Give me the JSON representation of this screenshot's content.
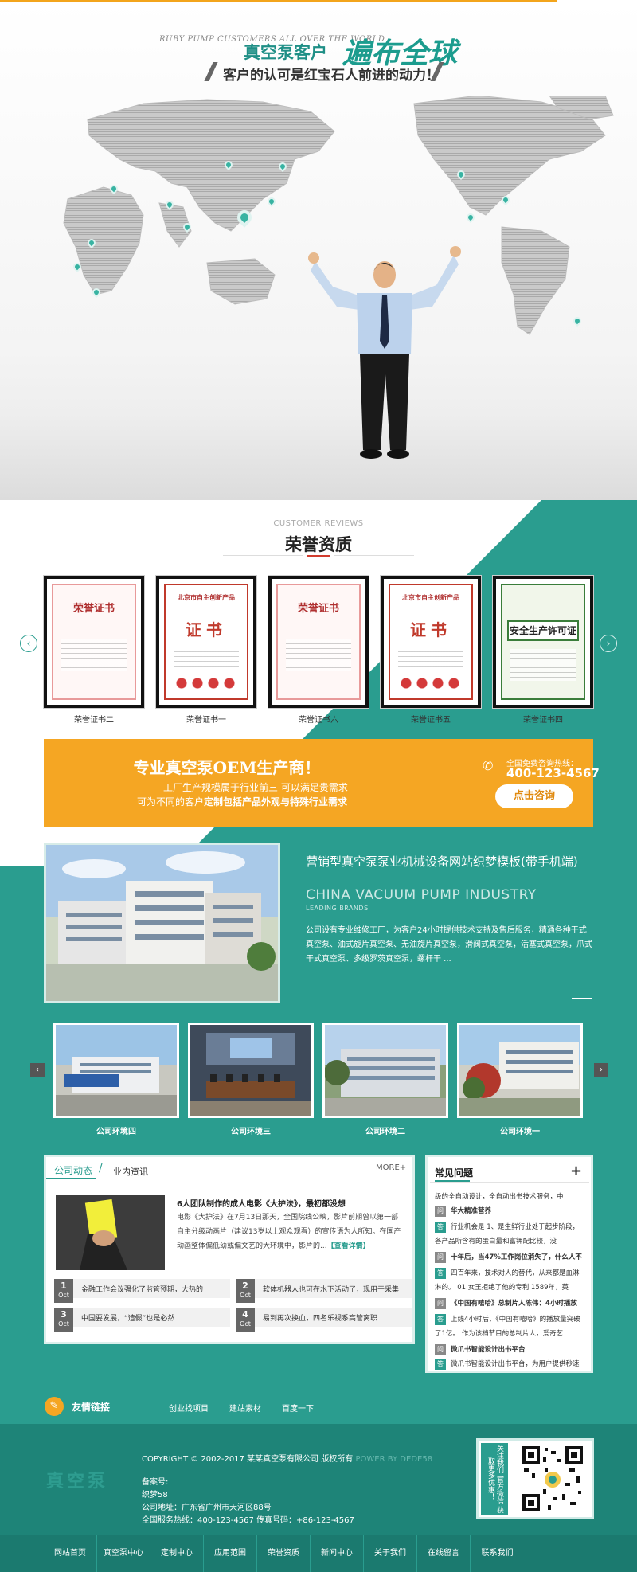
{
  "hero": {
    "subtitle": "RUBY PUMP CUSTOMERS ALL OVER THE WORLD",
    "title_a": "真空泵客户",
    "title_b": "遍布全球",
    "slogan": "客户的认可是红宝石人前进的动力！"
  },
  "honors": {
    "sub": "CUSTOMER REVIEWS",
    "title": "荣誉资质",
    "certs": [
      {
        "head": "荣誉证书",
        "label": "荣誉证书二"
      },
      {
        "head": "北京市自主创新产品",
        "big": "证书",
        "label": "荣誉证书一"
      },
      {
        "head": "荣誉证书",
        "label": "荣誉证书六"
      },
      {
        "head": "北京市自主创新产品",
        "big": "证书",
        "label": "荣誉证书五"
      },
      {
        "head": "安全生产许可证",
        "label": "荣誉证书四"
      }
    ],
    "prev": "‹",
    "next": "›"
  },
  "oem": {
    "title": "专业真空泵OEM生产商！",
    "line1": "工厂生产规模属于行业前三 可以满足贵需求",
    "line2_prefix": "可为不同的客户",
    "line2_bold": "定制包括产品外观与特殊行业需求",
    "hotline_label": "全国免费咨询热线：",
    "hotline": "400-123-4567",
    "button": "点击咨询"
  },
  "about": {
    "title": "营销型真空泵泵业机械设备网站织梦模板(带手机端)",
    "en": "CHINA VACUUM PUMP INDUSTRY",
    "en2": "LEADING BRANDS",
    "body": "公司设有专业维修工厂，为客户24小时提供技术支持及售后服务，精通各种干式真空泵、油式旋片真空泵、无油旋片真空泵，滑阀式真空泵，活塞式真空泵，爪式干式真空泵、多级罗茨真空泵，螺杆干 ..."
  },
  "environment": {
    "items": [
      {
        "label": "公司环境四"
      },
      {
        "label": "公司环境三"
      },
      {
        "label": "公司环境二"
      },
      {
        "label": "公司环境一"
      }
    ],
    "prev": "‹",
    "next": "›"
  },
  "news": {
    "tab_a": "公司动态",
    "tab_sep": "/",
    "tab_b": "业内资讯",
    "more": "MORE+",
    "featured_title": "6人团队制作的成人电影《大护法》，最初都没想",
    "featured_body": "电影《大护法》在7月13日那天，全国院线公映，影片前期曾以第一部自主分级动画片（建议13岁以上观众观看）的宣传语为人所知。在国产动画整体偏低幼或偏文艺的大环境中，影片的...",
    "featured_more": "【查看详情】",
    "items": [
      {
        "day": "1",
        "month": "Oct",
        "text": "金融工作会议强化了监管预期，大热的"
      },
      {
        "day": "2",
        "month": "Oct",
        "text": "软体机器人也可在水下活动了，现用于采集"
      },
      {
        "day": "3",
        "month": "Oct",
        "text": "中国要发展，“造假”也是必然"
      },
      {
        "day": "4",
        "month": "Oct",
        "text": "易到再次换血，四名乐视系高管离职"
      }
    ]
  },
  "faq": {
    "title": "常见问题",
    "plus": "+",
    "rows": [
      {
        "tag": "",
        "text": "级的全自动设计，全自动出书技术服务，中"
      },
      {
        "tag": "问",
        "text": "华大精准营养"
      },
      {
        "tag": "答",
        "text": "行业机会是 1、是生鲜行业处于起步阶段，"
      },
      {
        "tag": "",
        "text": "各产品所含有的蛋白量和富钾配比较，没"
      },
      {
        "tag": "问",
        "text": "十年后，当47%工作岗位消失了，什么人不"
      },
      {
        "tag": "答",
        "text": "四百年来，技术对人的替代，从来都是血淋"
      },
      {
        "tag": "",
        "text": "淋的。 01 女王拒绝了他的专利 1589年，英"
      },
      {
        "tag": "问",
        "text": "《中国有嘻哈》总制片人陈伟：4小时播放"
      },
      {
        "tag": "答",
        "text": "上线4小时后，《中国有嘻哈》的播放量突破"
      },
      {
        "tag": "",
        "text": "了1亿。 作为该档节目的总制片人，爱奇艺"
      },
      {
        "tag": "问",
        "text": "微爪书智能设计出书平台"
      },
      {
        "tag": "答",
        "text": "微爪书智能设计出书平台，为用户提供秒速"
      }
    ]
  },
  "links": {
    "icon": "✎",
    "title": "友情链接",
    "items": [
      "创业找项目",
      "建站素材",
      "百度一下"
    ]
  },
  "footer": {
    "logo": "真空泵",
    "copyright": "COPYRIGHT © 2002-2017 某某真空泵有限公司 版权所有",
    "power": "POWER BY DEDE58",
    "icp_label": "备案号:",
    "icp": "织梦58",
    "address": "公司地址：广东省广州市天河区88号",
    "phones": "全国服务热线：400-123-4567  传真号码：+86-123-4567",
    "qr_text": "关注我们 官方微信 获取更多优惠！"
  },
  "bottom_nav": [
    "网站首页",
    "真空泵中心",
    "定制中心",
    "应用范围",
    "荣誉资质",
    "新闻中心",
    "关于我们",
    "在线留言",
    "联系我们"
  ]
}
